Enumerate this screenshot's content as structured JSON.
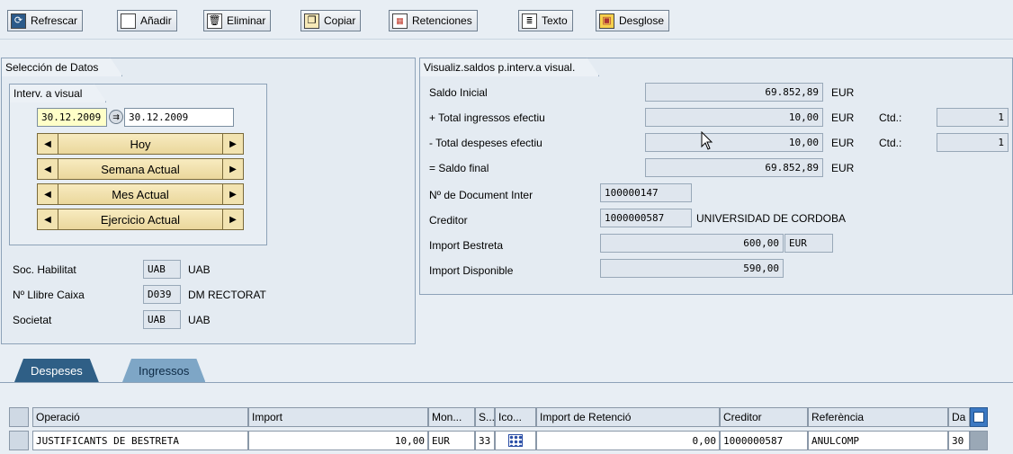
{
  "toolbar": {
    "buttons": [
      {
        "label": "Refrescar",
        "icon": "refresh-icon"
      },
      {
        "label": "Añadir",
        "icon": "new-document-icon"
      },
      {
        "label": "Eliminar",
        "icon": "trash-icon"
      },
      {
        "label": "Copiar",
        "icon": "copy-icon"
      },
      {
        "label": "Retenciones",
        "icon": "retentions-icon"
      },
      {
        "label": "Texto",
        "icon": "text-icon"
      },
      {
        "label": "Desglose",
        "icon": "breakdown-icon"
      }
    ]
  },
  "seleccion": {
    "title": "Selección de Datos",
    "interv": {
      "title": "Interv. a visual",
      "date_from": "30.12.2009",
      "date_to": "30.12.2009",
      "nav": [
        "Hoy",
        "Semana Actual",
        "Mes Actual",
        "Ejercicio Actual"
      ]
    },
    "fields": [
      {
        "label": "Soc. Habilitat",
        "code": "UAB",
        "text": "UAB"
      },
      {
        "label": "Nº Llibre Caixa",
        "code": "D039",
        "text": "DM RECTORAT"
      },
      {
        "label": "Societat",
        "code": "UAB",
        "text": "UAB"
      }
    ]
  },
  "saldos": {
    "title": "Visualiz.saldos p.interv.a visual.",
    "saldo_inicial_label": "Saldo Inicial",
    "saldo_inicial": "69.852,89",
    "ingresos_label": "+ Total ingressos efectiu",
    "ingresos": "10,00",
    "ingresos_ctd": "1",
    "despeses_label": "- Total despeses efectiu",
    "despeses": "10,00",
    "despeses_ctd": "1",
    "saldo_final_label": "= Saldo final",
    "saldo_final": "69.852,89",
    "currency": "EUR",
    "ctd_label": "Ctd.:",
    "doc_label": "Nº de Document Inter",
    "doc": "100000147",
    "creditor_label": "Creditor",
    "creditor_code": "1000000587",
    "creditor_name": "UNIVERSIDAD DE CORDOBA",
    "bestreta_label": "Import Bestreta",
    "bestreta": "600,00",
    "bestreta_cur": "EUR",
    "disponible_label": "Import Disponible",
    "disponible": "590,00"
  },
  "tabs": [
    {
      "label": "Despeses",
      "active": true
    },
    {
      "label": "Ingressos",
      "active": false
    }
  ],
  "table": {
    "headers": [
      "Operació",
      "Import",
      "Mon...",
      "S...",
      "Ico...",
      "Import de Retenció",
      "Creditor",
      "Referència",
      "Da"
    ],
    "rows": [
      [
        "JUSTIFICANTS DE BESTRETA",
        "10,00",
        "EUR",
        "33",
        "",
        "0,00",
        "1000000587",
        "ANULCOMP",
        "30"
      ]
    ]
  },
  "colors": {
    "background": "#e8eef4",
    "nav_button": "#f2e3b0",
    "active_tab": "#2f5f86",
    "inactive_tab": "#7ea6c6"
  }
}
